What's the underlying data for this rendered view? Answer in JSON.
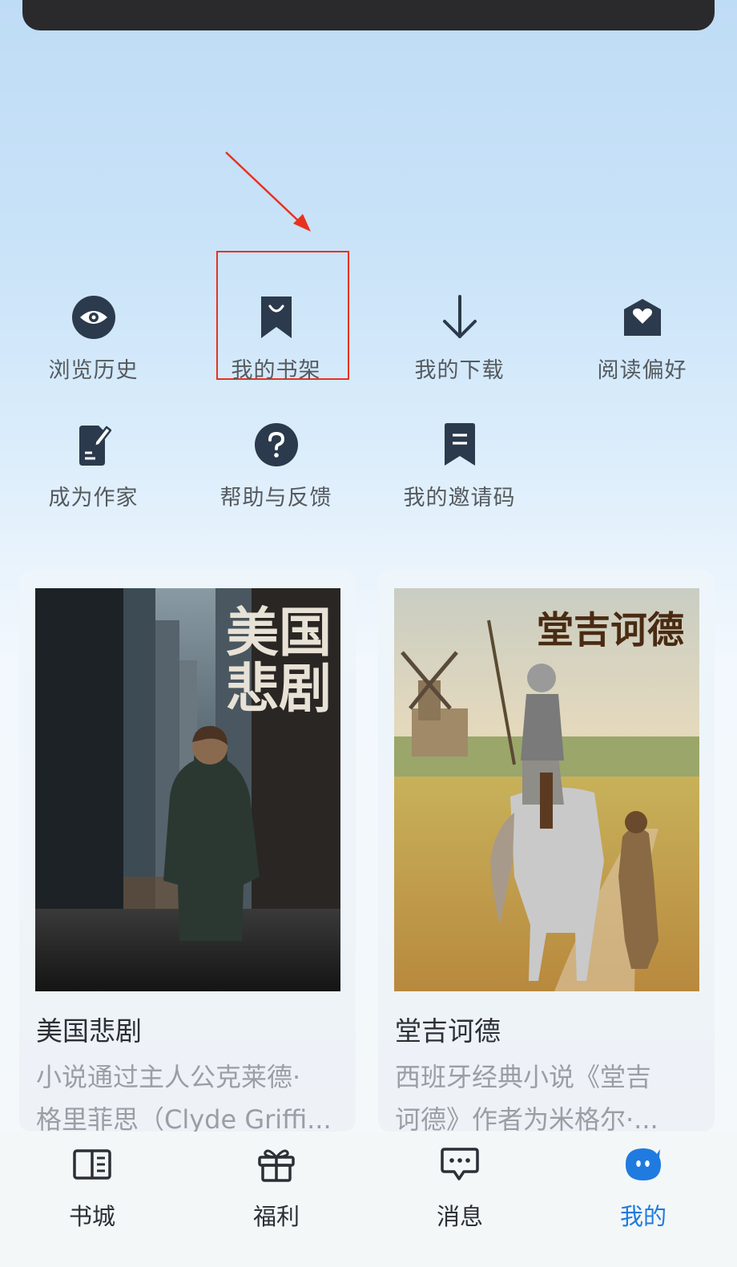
{
  "menu": {
    "items": [
      {
        "label": "浏览历史",
        "icon": "eye-icon"
      },
      {
        "label": "我的书架",
        "icon": "bookmark-smile-icon",
        "highlighted": true
      },
      {
        "label": "我的下载",
        "icon": "download-arrow-icon"
      },
      {
        "label": "阅读偏好",
        "icon": "heart-envelope-icon"
      },
      {
        "label": "成为作家",
        "icon": "edit-document-icon"
      },
      {
        "label": "帮助与反馈",
        "icon": "question-circle-icon"
      },
      {
        "label": "我的邀请码",
        "icon": "bookmark-lines-icon"
      }
    ]
  },
  "books": [
    {
      "cover_text": [
        "美国",
        "悲剧"
      ],
      "title": "美国悲剧",
      "desc_line1": "小说通过主人公克莱德·",
      "desc_line2": "格里菲思（Clyde Griffi..."
    },
    {
      "cover_text": [
        "堂吉诃德"
      ],
      "title": "堂吉诃德",
      "desc_line1": "西班牙经典小说《堂吉",
      "desc_line2": "诃德》作者为米格尔·..."
    }
  ],
  "tabbar": {
    "tabs": [
      {
        "label": "书城",
        "icon": "open-book-icon"
      },
      {
        "label": "福利",
        "icon": "gift-icon"
      },
      {
        "label": "消息",
        "icon": "chat-bubble-icon"
      },
      {
        "label": "我的",
        "icon": "profile-blob-icon",
        "active": true
      }
    ]
  },
  "colors": {
    "accent": "#1f7be0",
    "icon_dark": "#2b3a4c",
    "annotation_red": "#e8321e"
  }
}
